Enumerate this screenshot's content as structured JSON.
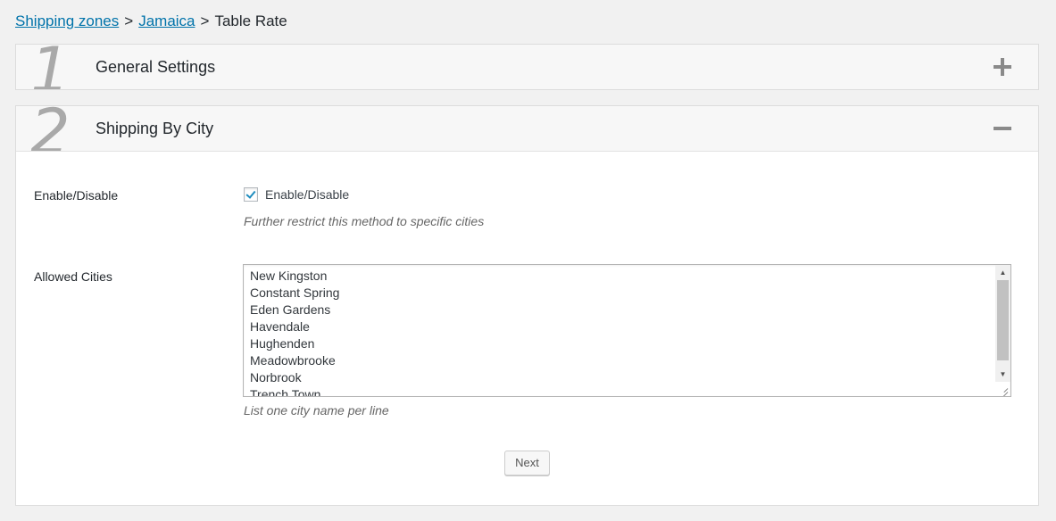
{
  "breadcrumb": {
    "items": [
      {
        "label": "Shipping zones",
        "link": true
      },
      {
        "label": "Jamaica",
        "link": true
      },
      {
        "label": "Table Rate",
        "link": false
      }
    ],
    "separator": ">"
  },
  "sections": [
    {
      "number": "1",
      "title": "General Settings",
      "state": "collapsed",
      "toggle_icon": "plus-icon"
    },
    {
      "number": "2",
      "title": "Shipping By City",
      "state": "expanded",
      "toggle_icon": "minus-icon"
    }
  ],
  "form": {
    "enable": {
      "label": "Enable/Disable",
      "checkbox_label": "Enable/Disable",
      "checked": true,
      "help": "Further restrict this method to specific cities"
    },
    "cities": {
      "label": "Allowed Cities",
      "lines": [
        "New Kingston",
        "Constant Spring",
        "Eden Gardens",
        "Havendale",
        "Hughenden",
        "Meadowbrooke",
        "Norbrook",
        "Trench Town"
      ],
      "help": "List one city name per line"
    },
    "next_label": "Next"
  },
  "colors": {
    "link": "#0073aa",
    "accent": "#1e8cbe"
  }
}
